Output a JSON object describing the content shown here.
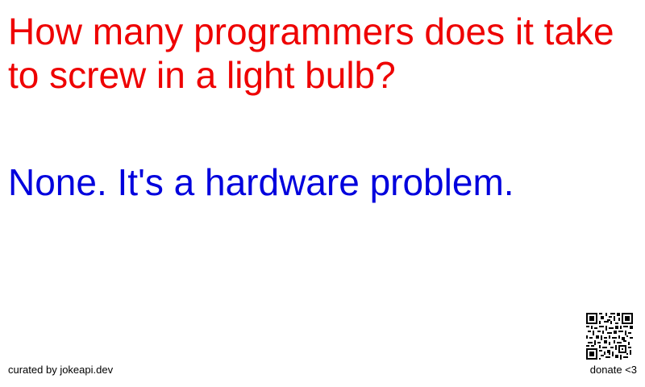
{
  "joke": {
    "setup": "How many programmers does it take to screw in a light bulb?",
    "delivery": "None. It's a hardware problem."
  },
  "footer": {
    "credit": "curated by jokeapi.dev",
    "donate_label": "donate <3",
    "qr_icon": "qr-code-icon"
  },
  "colors": {
    "setup": "#ee0000",
    "delivery": "#0000dd",
    "footer_text": "#000000",
    "background": "#ffffff"
  }
}
